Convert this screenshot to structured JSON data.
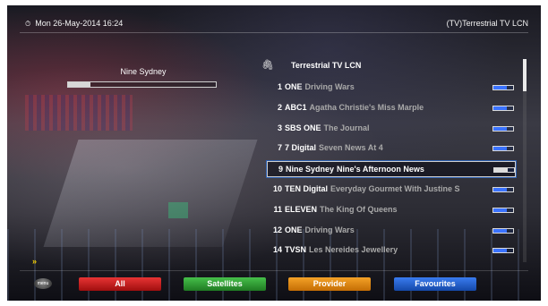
{
  "header": {
    "datetime": "Mon 26-May-2014 16:24",
    "mode": "(TV)Terrestrial TV LCN"
  },
  "current_channel": {
    "name": "Nine Sydney",
    "signal_level": 0.15
  },
  "channel_list": {
    "title": "Terrestrial TV LCN",
    "channels": [
      {
        "number": "1",
        "name": "ONE",
        "programme": "Driving Wars"
      },
      {
        "number": "2",
        "name": "ABC1",
        "programme": "Agatha Christie's Miss Marple"
      },
      {
        "number": "3",
        "name": "SBS ONE",
        "programme": "The Journal"
      },
      {
        "number": "7",
        "name": "7 Digital",
        "programme": "Seven News At 4"
      },
      {
        "number": "9",
        "name": "Nine Sydney",
        "programme": "Nine's Afternoon News"
      },
      {
        "number": "10",
        "name": "TEN Digital",
        "programme": "Everyday Gourmet With Justine S"
      },
      {
        "number": "11",
        "name": "ELEVEN",
        "programme": "The King Of Queens"
      },
      {
        "number": "12",
        "name": "ONE",
        "programme": "Driving Wars"
      },
      {
        "number": "14",
        "name": "TVSN",
        "programme": "Les Nereides Jewellery"
      }
    ],
    "selected_index": 4
  },
  "footer": {
    "menu_icon_label": "menu",
    "chevrons": "»",
    "buttons": {
      "red": "All",
      "green": "Satellites",
      "orange": "Provider",
      "blue": "Favourites"
    }
  },
  "colors": {
    "red": "#d01f1f",
    "green": "#33a038",
    "orange": "#f19a1c",
    "blue": "#2a65d8",
    "chevron": "#f5d000",
    "signal_blue": "#3b73ff"
  }
}
